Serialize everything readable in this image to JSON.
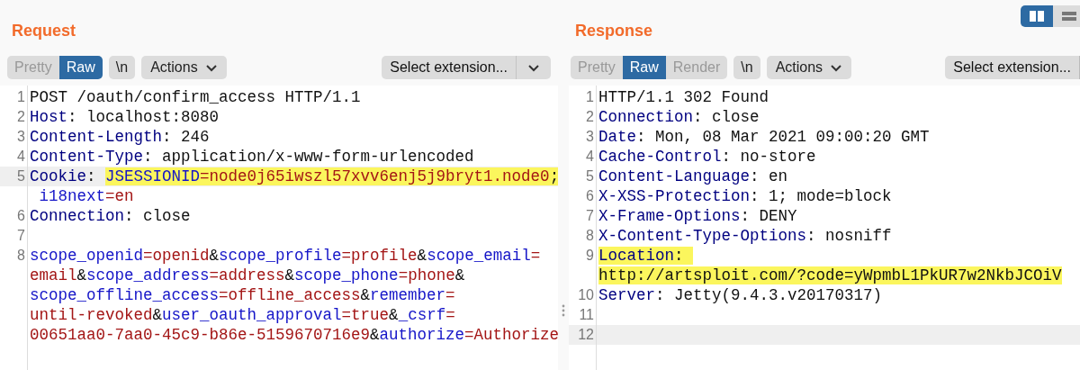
{
  "panes": [
    {
      "title": "Request",
      "view_tabs": [
        {
          "label": "Pretty",
          "selected": false
        },
        {
          "label": "Raw",
          "selected": true
        }
      ],
      "newline_button": "\\n",
      "actions_button": "Actions",
      "extension_select": {
        "label": "Select extension...",
        "split_caret": true
      },
      "lines": [
        {
          "number": "1",
          "rows": [
            {
              "current": false,
              "tokens": [
                {
                  "text": "POST /oauth/confirm_access HTTP/1.1",
                  "kind": "plain",
                  "highlighted": false
                }
              ]
            }
          ]
        },
        {
          "number": "2",
          "rows": [
            {
              "current": false,
              "tokens": [
                {
                  "text": "Host",
                  "kind": "header",
                  "highlighted": false
                },
                {
                  "text": ": localhost:8080",
                  "kind": "plain",
                  "highlighted": false
                }
              ]
            }
          ]
        },
        {
          "number": "3",
          "rows": [
            {
              "current": false,
              "tokens": [
                {
                  "text": "Content-Length",
                  "kind": "header",
                  "highlighted": false
                },
                {
                  "text": ": 246",
                  "kind": "plain",
                  "highlighted": false
                }
              ]
            }
          ]
        },
        {
          "number": "4",
          "rows": [
            {
              "current": false,
              "tokens": [
                {
                  "text": "Content-Type",
                  "kind": "header",
                  "highlighted": false
                },
                {
                  "text": ": application/x-www-form-urlencoded",
                  "kind": "plain",
                  "highlighted": false
                }
              ]
            }
          ]
        },
        {
          "number": "5",
          "rows": [
            {
              "current": true,
              "tokens": [
                {
                  "text": "Cookie",
                  "kind": "header",
                  "highlighted": false
                },
                {
                  "text": ": ",
                  "kind": "plain",
                  "highlighted": false
                },
                {
                  "text": "JSESSIONID",
                  "kind": "param",
                  "highlighted": true
                },
                {
                  "text": "=node0j65iwszl57xvv6enj5j9bryt1.node0",
                  "kind": "value",
                  "highlighted": true
                },
                {
                  "text": ";",
                  "kind": "plain",
                  "highlighted": true
                }
              ]
            },
            {
              "current": false,
              "tokens": [
                {
                  "text": " i18next",
                  "kind": "param",
                  "highlighted": false
                },
                {
                  "text": "=en",
                  "kind": "value",
                  "highlighted": false
                }
              ]
            }
          ]
        },
        {
          "number": "6",
          "rows": [
            {
              "current": false,
              "tokens": [
                {
                  "text": "Connection",
                  "kind": "header",
                  "highlighted": false
                },
                {
                  "text": ": close",
                  "kind": "plain",
                  "highlighted": false
                }
              ]
            }
          ]
        },
        {
          "number": "7",
          "rows": [
            {
              "current": false,
              "tokens": []
            }
          ]
        },
        {
          "number": "8",
          "rows": [
            {
              "current": false,
              "tokens": [
                {
                  "text": "scope_openid",
                  "kind": "param",
                  "highlighted": false
                },
                {
                  "text": "=openid",
                  "kind": "value",
                  "highlighted": false
                },
                {
                  "text": "&",
                  "kind": "plain",
                  "highlighted": false
                },
                {
                  "text": "scope_profile",
                  "kind": "param",
                  "highlighted": false
                },
                {
                  "text": "=profile",
                  "kind": "value",
                  "highlighted": false
                },
                {
                  "text": "&",
                  "kind": "plain",
                  "highlighted": false
                },
                {
                  "text": "scope_email",
                  "kind": "param",
                  "highlighted": false
                },
                {
                  "text": "=",
                  "kind": "value",
                  "highlighted": false
                }
              ]
            },
            {
              "current": false,
              "tokens": [
                {
                  "text": "email",
                  "kind": "value",
                  "highlighted": false
                },
                {
                  "text": "&",
                  "kind": "plain",
                  "highlighted": false
                },
                {
                  "text": "scope_address",
                  "kind": "param",
                  "highlighted": false
                },
                {
                  "text": "=address",
                  "kind": "value",
                  "highlighted": false
                },
                {
                  "text": "&",
                  "kind": "plain",
                  "highlighted": false
                },
                {
                  "text": "scope_phone",
                  "kind": "param",
                  "highlighted": false
                },
                {
                  "text": "=phone",
                  "kind": "value",
                  "highlighted": false
                },
                {
                  "text": "&",
                  "kind": "plain",
                  "highlighted": false
                }
              ]
            },
            {
              "current": false,
              "tokens": [
                {
                  "text": "scope_offline_access",
                  "kind": "param",
                  "highlighted": false
                },
                {
                  "text": "=offline_access",
                  "kind": "value",
                  "highlighted": false
                },
                {
                  "text": "&",
                  "kind": "plain",
                  "highlighted": false
                },
                {
                  "text": "remember",
                  "kind": "param",
                  "highlighted": false
                },
                {
                  "text": "=",
                  "kind": "value",
                  "highlighted": false
                }
              ]
            },
            {
              "current": false,
              "tokens": [
                {
                  "text": "until-revoked",
                  "kind": "value",
                  "highlighted": false
                },
                {
                  "text": "&",
                  "kind": "plain",
                  "highlighted": false
                },
                {
                  "text": "user_oauth_approval",
                  "kind": "param",
                  "highlighted": false
                },
                {
                  "text": "=true",
                  "kind": "value",
                  "highlighted": false
                },
                {
                  "text": "&",
                  "kind": "plain",
                  "highlighted": false
                },
                {
                  "text": "_csrf",
                  "kind": "param",
                  "highlighted": false
                },
                {
                  "text": "=",
                  "kind": "value",
                  "highlighted": false
                }
              ]
            },
            {
              "current": false,
              "tokens": [
                {
                  "text": "00651aa0-7aa0-45c9-b86e-5159670716e9",
                  "kind": "value",
                  "highlighted": false
                },
                {
                  "text": "&",
                  "kind": "plain",
                  "highlighted": false
                },
                {
                  "text": "authorize",
                  "kind": "param",
                  "highlighted": false
                },
                {
                  "text": "=Authorize",
                  "kind": "value",
                  "highlighted": false
                }
              ]
            }
          ]
        }
      ]
    },
    {
      "title": "Response",
      "layout_toggle": [
        {
          "kind": "columns",
          "selected": true
        },
        {
          "kind": "rows",
          "selected": false
        }
      ],
      "view_tabs": [
        {
          "label": "Pretty",
          "selected": false
        },
        {
          "label": "Raw",
          "selected": true
        },
        {
          "label": "Render",
          "selected": false
        }
      ],
      "newline_button": "\\n",
      "actions_button": "Actions",
      "extension_select": {
        "label": "Select extension...",
        "split_caret": false
      },
      "lines": [
        {
          "number": "1",
          "rows": [
            {
              "current": false,
              "tokens": [
                {
                  "text": "HTTP/1.1 302 Found",
                  "kind": "plain",
                  "highlighted": false
                }
              ]
            }
          ]
        },
        {
          "number": "2",
          "rows": [
            {
              "current": false,
              "tokens": [
                {
                  "text": "Connection",
                  "kind": "header",
                  "highlighted": false
                },
                {
                  "text": ": close",
                  "kind": "plain",
                  "highlighted": false
                }
              ]
            }
          ]
        },
        {
          "number": "3",
          "rows": [
            {
              "current": false,
              "tokens": [
                {
                  "text": "Date",
                  "kind": "header",
                  "highlighted": false
                },
                {
                  "text": ": Mon, 08 Mar 2021 09:00:20 GMT",
                  "kind": "plain",
                  "highlighted": false
                }
              ]
            }
          ]
        },
        {
          "number": "4",
          "rows": [
            {
              "current": false,
              "tokens": [
                {
                  "text": "Cache-Control",
                  "kind": "header",
                  "highlighted": false
                },
                {
                  "text": ": no-store",
                  "kind": "plain",
                  "highlighted": false
                }
              ]
            }
          ]
        },
        {
          "number": "5",
          "rows": [
            {
              "current": false,
              "tokens": [
                {
                  "text": "Content-Language",
                  "kind": "header",
                  "highlighted": false
                },
                {
                  "text": ": en",
                  "kind": "plain",
                  "highlighted": false
                }
              ]
            }
          ]
        },
        {
          "number": "6",
          "rows": [
            {
              "current": false,
              "tokens": [
                {
                  "text": "X-XSS-Protection",
                  "kind": "header",
                  "highlighted": false
                },
                {
                  "text": ": 1; mode=block",
                  "kind": "plain",
                  "highlighted": false
                }
              ]
            }
          ]
        },
        {
          "number": "7",
          "rows": [
            {
              "current": false,
              "tokens": [
                {
                  "text": "X-Frame-Options",
                  "kind": "header",
                  "highlighted": false
                },
                {
                  "text": ": DENY",
                  "kind": "plain",
                  "highlighted": false
                }
              ]
            }
          ]
        },
        {
          "number": "8",
          "rows": [
            {
              "current": false,
              "tokens": [
                {
                  "text": "X-Content-Type-Options",
                  "kind": "header",
                  "highlighted": false
                },
                {
                  "text": ": nosniff",
                  "kind": "plain",
                  "highlighted": false
                }
              ]
            }
          ]
        },
        {
          "number": "9",
          "rows": [
            {
              "current": false,
              "tokens": [
                {
                  "text": "Location",
                  "kind": "header",
                  "highlighted": true
                },
                {
                  "text": ": ",
                  "kind": "plain",
                  "highlighted": true
                }
              ]
            },
            {
              "current": false,
              "tokens": [
                {
                  "text": "http://artsploit.com/?code=yWpmbL1PkUR7w2NkbJCOiV",
                  "kind": "plain",
                  "highlighted": true
                }
              ]
            }
          ]
        },
        {
          "number": "10",
          "rows": [
            {
              "current": false,
              "tokens": [
                {
                  "text": "Server",
                  "kind": "header",
                  "highlighted": false
                },
                {
                  "text": ": Jetty(9.4.3.v20170317)",
                  "kind": "plain",
                  "highlighted": false
                }
              ]
            }
          ]
        },
        {
          "number": "11",
          "rows": [
            {
              "current": false,
              "tokens": []
            }
          ]
        },
        {
          "number": "12",
          "rows": [
            {
              "current": true,
              "tokens": []
            }
          ]
        }
      ]
    }
  ]
}
